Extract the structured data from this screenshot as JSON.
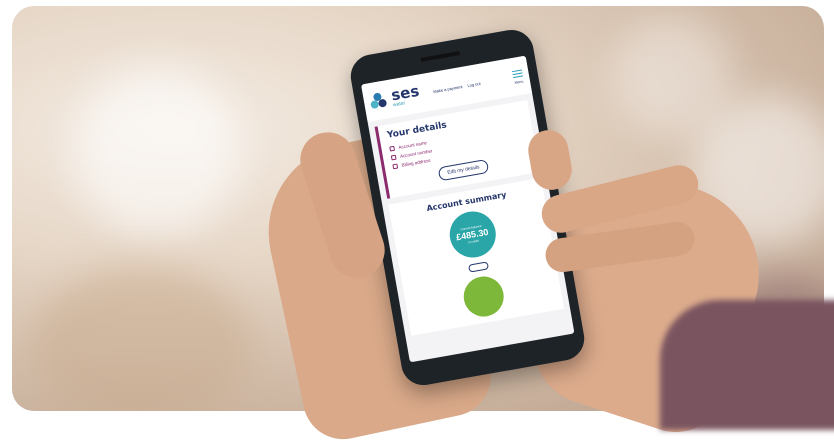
{
  "phone_screen": {
    "logo": {
      "brand": "ses",
      "sub": "water"
    },
    "nav": {
      "links": [
        "Make a payment",
        "Log out"
      ],
      "menu_label": "Menu"
    },
    "your_details": {
      "title": "Your details",
      "rows": [
        "Account name",
        "Account number",
        "Billing address"
      ],
      "edit_button": "Edit my details"
    },
    "account_summary": {
      "title": "Account summary",
      "balance_label": "Current balance",
      "balance_value": "£485.30",
      "balance_status": "in credit"
    }
  },
  "colors": {
    "brand_navy": "#24366b",
    "brand_teal": "#2aa5a8",
    "accent_purple": "#8c2a6e",
    "accent_green": "#7db83a"
  }
}
